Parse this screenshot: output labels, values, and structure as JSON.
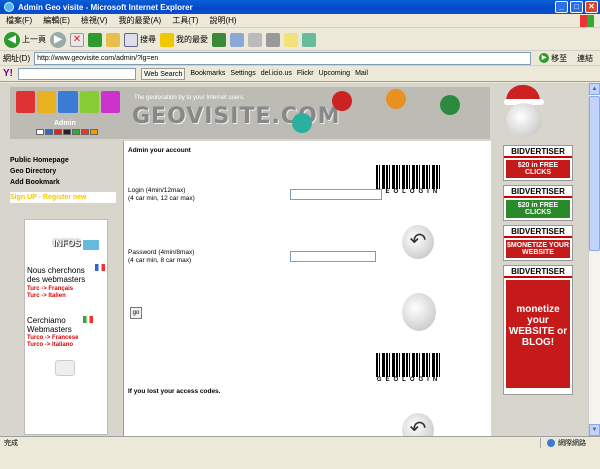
{
  "window": {
    "title": "Admin Geo visite - Microsoft Internet Explorer",
    "min": "_",
    "max": "□",
    "close": "✕"
  },
  "menu": [
    "檔案(F)",
    "編輯(E)",
    "檢視(V)",
    "我的最愛(A)",
    "工具(T)",
    "說明(H)"
  ],
  "toolbar": {
    "back": "上一頁",
    "search": "搜尋",
    "favorites": "我的最愛"
  },
  "address": {
    "label": "網址(D)",
    "url": "http://www.geovisite.com/admin/?lg=en",
    "go": "移至",
    "links": "連結"
  },
  "yahoo": {
    "logo": "Y!",
    "web_search": "Web Search",
    "bookmarks": "Bookmarks",
    "settings": "Settings",
    "delicious": "del.icio.us",
    "flickr": "Flickr",
    "upcoming": "Upcoming",
    "mail": "Mail"
  },
  "header": {
    "tagline": "The geolocation by to your Internet users.",
    "logo": "GEOVISITE.COM",
    "admin_label": "Admin"
  },
  "nav": {
    "public_homepage": "Public Homepage",
    "geo_directory": "Geo Directory",
    "add_bookmark": "Add Bookmark",
    "sign_up": "Sign UP - Register new"
  },
  "infos": {
    "title": "INFOS",
    "fr_text": "Nous cherchons des webmasters",
    "fr_l1": "Turc -> Français",
    "fr_l2": "Turc -> Italien",
    "it_text": "Cerchiamo Webmasters",
    "it_l1": "Turco -> Francese",
    "it_l2": "Turco -> Italiano"
  },
  "content": {
    "heading": "Admin your account",
    "login_label": "Login (4min/12max)",
    "login_hint": "(4 car min, 12 car max)",
    "password_label": "Password (4min/8max)",
    "password_hint": "(4 car min, 8 car max)",
    "go": "go",
    "lost": "If you lost your access codes.",
    "barcode_text": "GEOLOGIN"
  },
  "ads": [
    {
      "brand": "BIDVERTISER",
      "text": "$20 in FREE CLICKS",
      "color": "#c41a1a"
    },
    {
      "brand": "BIDVERTISER",
      "text": "$20 in FREE CLICKS",
      "color": "#2a8a2a"
    },
    {
      "brand": "BIDVERTISER",
      "text": "$MONETIZE YOUR WEBSITE",
      "color": "#c41a1a"
    },
    {
      "brand": "BIDVERTISER",
      "text": "monetize your WEBSITE or BLOG!",
      "color": "#c41a1a"
    }
  ],
  "status": {
    "left": "完成",
    "zone": "網際網路"
  }
}
